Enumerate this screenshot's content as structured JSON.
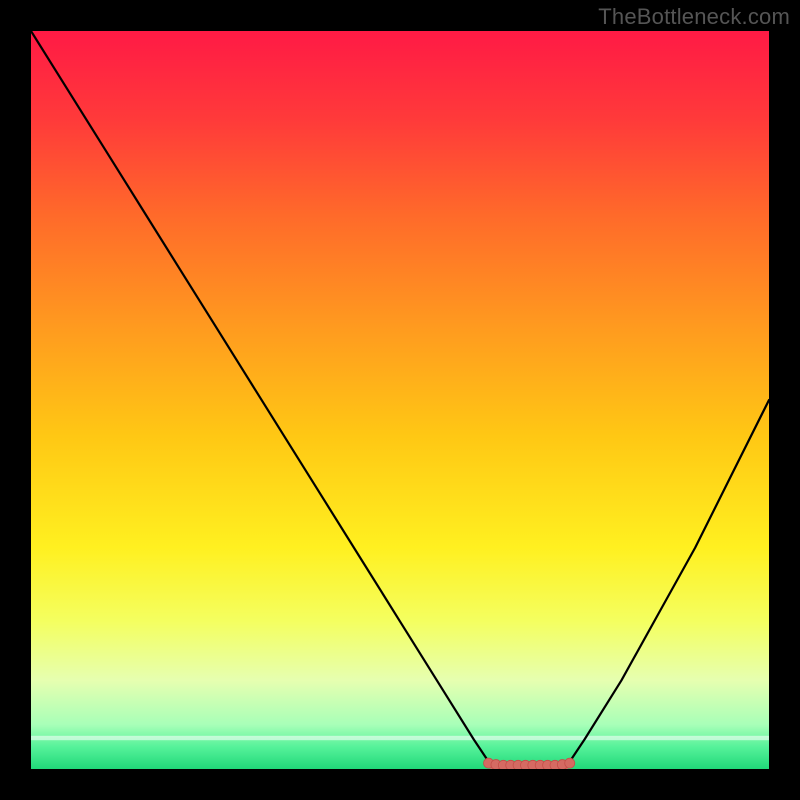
{
  "watermark": "TheBottleneck.com",
  "colors": {
    "black": "#000000",
    "curve_stroke": "#000000",
    "marker_fill": "#d56a62",
    "marker_stroke": "#c54f49",
    "gradient_stops": [
      {
        "offset": 0.0,
        "color": "#ff1a45"
      },
      {
        "offset": 0.12,
        "color": "#ff3a3a"
      },
      {
        "offset": 0.25,
        "color": "#ff6a2a"
      },
      {
        "offset": 0.4,
        "color": "#ff9a1f"
      },
      {
        "offset": 0.55,
        "color": "#ffc814"
      },
      {
        "offset": 0.7,
        "color": "#fff020"
      },
      {
        "offset": 0.8,
        "color": "#f4ff60"
      },
      {
        "offset": 0.88,
        "color": "#e6ffb0"
      },
      {
        "offset": 0.94,
        "color": "#a8ffb8"
      },
      {
        "offset": 0.97,
        "color": "#56f29a"
      },
      {
        "offset": 1.0,
        "color": "#20d879"
      }
    ]
  },
  "chart_data": {
    "type": "line",
    "title": "",
    "xlabel": "",
    "ylabel": "",
    "xlim": [
      0,
      100
    ],
    "ylim": [
      0,
      100
    ],
    "grid": false,
    "legend": false,
    "annotations": [],
    "series": [
      {
        "name": "bottleneck-curve",
        "x": [
          0,
          5,
          10,
          15,
          20,
          25,
          30,
          35,
          40,
          45,
          50,
          55,
          60,
          62,
          65,
          70,
          73,
          75,
          80,
          85,
          90,
          95,
          100
        ],
        "values": [
          100,
          92,
          84,
          76,
          68,
          60,
          52,
          44,
          36,
          28,
          20,
          12,
          4,
          1,
          0,
          0,
          1,
          4,
          12,
          21,
          30,
          40,
          50
        ]
      }
    ],
    "flat_region": {
      "x_start": 62,
      "x_end": 73,
      "y": 0.5
    },
    "markers": {
      "x": [
        62,
        63,
        64,
        65,
        66,
        67,
        68,
        69,
        70,
        71,
        72,
        73
      ],
      "values": [
        0.8,
        0.6,
        0.5,
        0.5,
        0.5,
        0.5,
        0.5,
        0.5,
        0.5,
        0.5,
        0.6,
        0.8
      ]
    }
  }
}
